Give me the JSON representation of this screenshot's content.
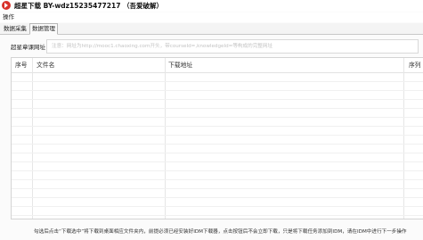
{
  "window": {
    "title": "超星下载 BY-wdz15235477217 （吾爱破解）"
  },
  "menu": {
    "items": [
      {
        "label": "操作"
      }
    ]
  },
  "tabs": [
    {
      "label": "数据采集",
      "active": false
    },
    {
      "label": "数据管理",
      "active": true
    }
  ],
  "url_field": {
    "label": "超星章课网址",
    "placeholder": "注意：网址为http://mooc1.chaoxing.com开头，带courseId=,knowledgeId=等构成的完整网址",
    "value": ""
  },
  "table": {
    "columns": [
      "序号",
      "文件名",
      "下载地址",
      "序列"
    ],
    "rows": []
  },
  "footer": {
    "text": "勾选后点击“下载选中”将下载到桌面相应文件夹内，前提必须已经安装好IDM下载器，点击按钮后不会立即下载，只是将下载任务添加到IDM，请在IDM中进行下一步操作"
  }
}
